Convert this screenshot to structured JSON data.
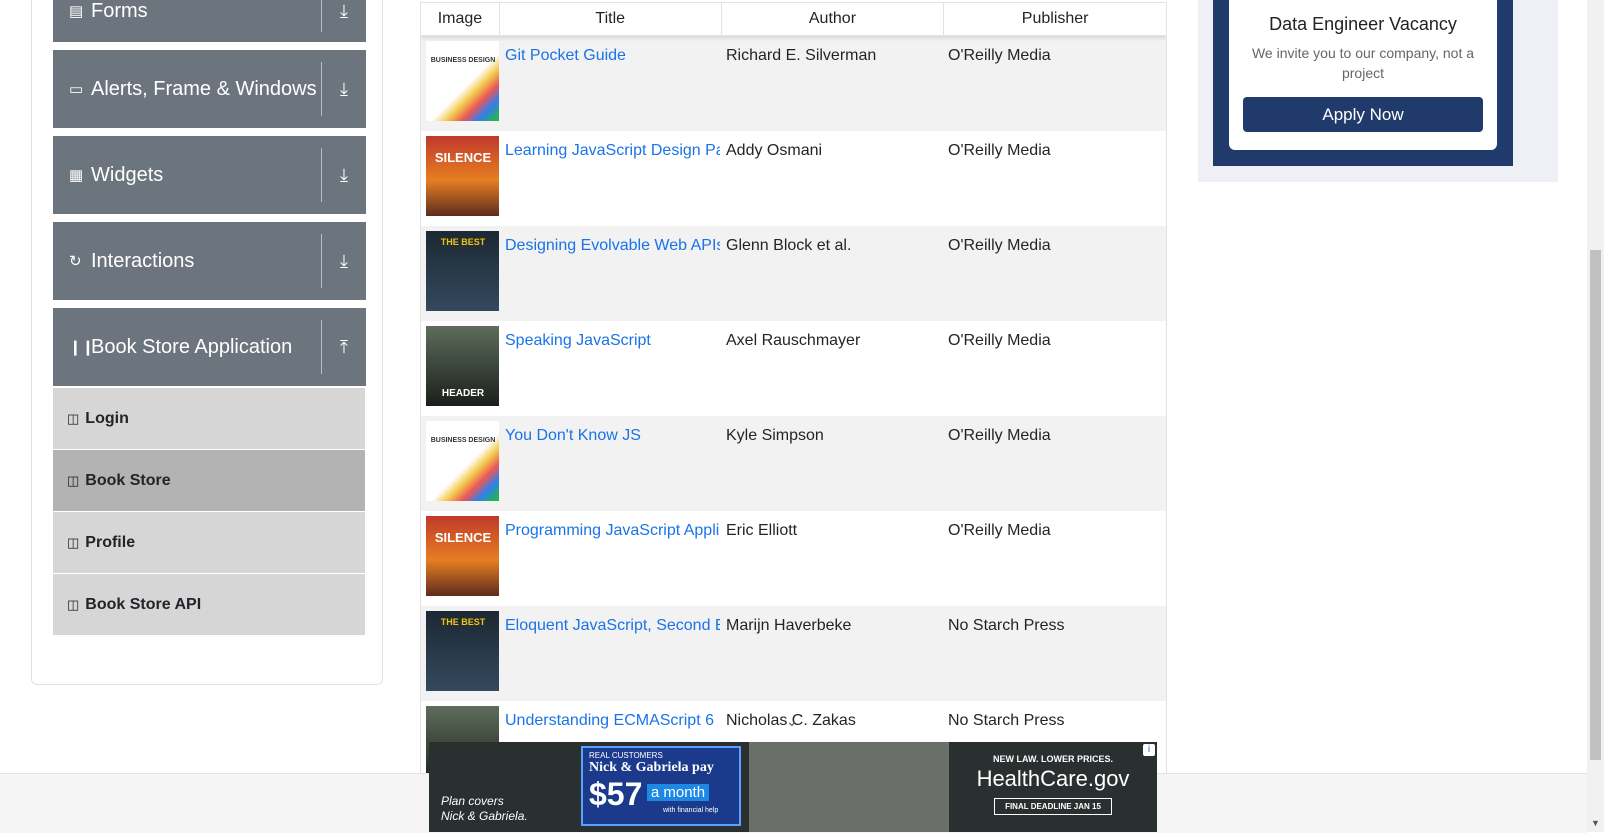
{
  "sidebar": {
    "groups": [
      {
        "label": "Forms",
        "icon": "form-icon",
        "arrow": "download-icon"
      },
      {
        "label": "Alerts, Frame & Windows",
        "icon": "window-icon",
        "arrow": "download-icon"
      },
      {
        "label": "Widgets",
        "icon": "widgets-icon",
        "arrow": "download-icon"
      },
      {
        "label": "Interactions",
        "icon": "interactions-icon",
        "arrow": "download-icon"
      },
      {
        "label": "Book Store Application",
        "icon": "books-icon",
        "arrow": "upload-icon"
      }
    ],
    "sub_items": [
      {
        "label": "Login",
        "active": false
      },
      {
        "label": "Book Store",
        "active": true
      },
      {
        "label": "Profile",
        "active": false
      },
      {
        "label": "Book Store API",
        "active": false
      }
    ]
  },
  "table": {
    "headers": [
      "Image",
      "Title",
      "Author",
      "Publisher"
    ],
    "rows": [
      {
        "title": "Git Pocket Guide",
        "author": "Richard E. Silverman",
        "publisher": "O'Reilly Media",
        "cover": "business-design"
      },
      {
        "title": "Learning JavaScript Design Pat",
        "author": "Addy Osmani",
        "publisher": "O'Reilly Media",
        "cover": "silence"
      },
      {
        "title": "Designing Evolvable Web APIs",
        "author": "Glenn Block et al.",
        "publisher": "O'Reilly Media",
        "cover": "stock-images"
      },
      {
        "title": "Speaking JavaScript",
        "author": "Axel Rauschmayer",
        "publisher": "O'Reilly Media",
        "cover": "header"
      },
      {
        "title": "You Don't Know JS",
        "author": "Kyle Simpson",
        "publisher": "O'Reilly Media",
        "cover": "business-design"
      },
      {
        "title": "Programming JavaScript Applic",
        "author": "Eric Elliott",
        "publisher": "O'Reilly Media",
        "cover": "silence"
      },
      {
        "title": "Eloquent JavaScript, Second Ec",
        "author": "Marijn Haverbeke",
        "publisher": "No Starch Press",
        "cover": "stock-images"
      },
      {
        "title": "Understanding ECMAScript 6",
        "author": "Nicholas C. Zakas",
        "publisher": "No Starch Press",
        "cover": "header"
      }
    ],
    "cover_text": {
      "business-design": "BUSINESS DESIGN",
      "silence": "SILENCE",
      "stock-images": "THE BEST",
      "header": "HEADER"
    }
  },
  "vacancy_ad": {
    "title": "Data Engineer Vacancy",
    "text": "We invite you to our company, not a project",
    "button": "Apply Now"
  },
  "banner_ad": {
    "plan_text_1": "Plan covers",
    "plan_text_2": "Nick & Gabriela.",
    "real_customers": "REAL CUSTOMERS",
    "names": "Nick & Gabriela pay",
    "price": "$57",
    "per": "a month",
    "financial": "with financial help",
    "law": "NEW LAW. LOWER PRICES.",
    "brand": "HealthCare.gov",
    "deadline": "FINAL DEADLINE JAN 15",
    "info": "i"
  },
  "colors": {
    "link": "#1a73e8",
    "sidebar_group": "#6c757d",
    "sub_item": "#d6d6d6",
    "sub_item_active": "#b3b3b3",
    "ad_navy": "#1f3a6b"
  }
}
